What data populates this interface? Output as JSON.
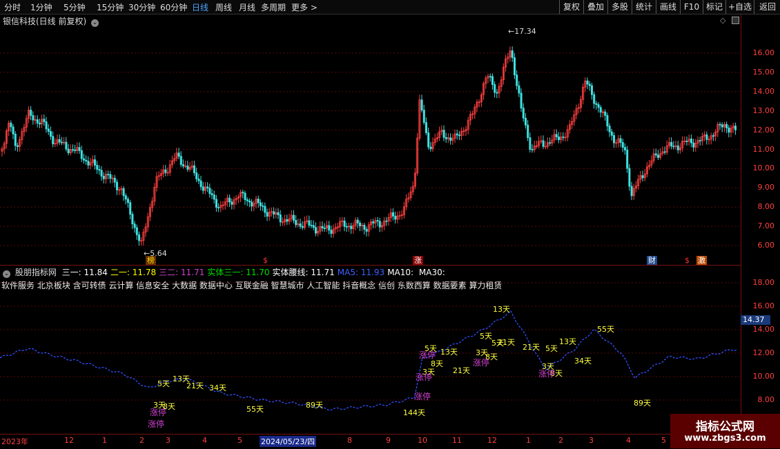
{
  "toolbar": {
    "periods": [
      "分时",
      "1分钟",
      "5分钟",
      "15分钟",
      "30分钟",
      "60分钟",
      "日线",
      "周线",
      "月线",
      "多周期",
      "更多 >"
    ],
    "active_period": "日线",
    "buttons": [
      "复权",
      "叠加",
      "多股",
      "统计",
      "画线",
      "F10",
      "标记",
      "+自选",
      "返回"
    ]
  },
  "main_pane": {
    "title": "银信科技(日线 前复权)",
    "price_high_label": "17.34",
    "price_low_label": "5.64",
    "y_ticks": [
      "16.00",
      "15.00",
      "14.00",
      "13.00",
      "12.00",
      "11.00",
      "10.00",
      "9.00",
      "8.00",
      "7.00",
      "6.00"
    ],
    "markers": [
      {
        "text": "榜",
        "color": "#ffd700",
        "bg": "#663300"
      },
      {
        "text": "$",
        "color": "#ff3030",
        "bg": "#000"
      },
      {
        "text": "涨",
        "color": "#ffffff",
        "bg": "#8b0000"
      },
      {
        "text": "财",
        "color": "#ffffff",
        "bg": "#1f4a8a"
      },
      {
        "text": "$",
        "color": "#ff3030",
        "bg": "#000"
      },
      {
        "text": "激",
        "color": "#ffffff",
        "bg": "#b84a00"
      }
    ]
  },
  "indicator_pane": {
    "name": "股朋指标网",
    "values": [
      {
        "label": "三一:",
        "value": "11.84",
        "color": "#ffffff"
      },
      {
        "label": "二一:",
        "value": "11.78",
        "color": "#ffff00"
      },
      {
        "label": "三二:",
        "value": "11.71",
        "color": "#d040d0"
      },
      {
        "label": "实体三一:",
        "value": "11.70",
        "color": "#00e000"
      },
      {
        "label": "实体腰线:",
        "value": "11.71",
        "color": "#ffffff"
      },
      {
        "label": "MA5:",
        "value": "11.93",
        "color": "#4060ff"
      },
      {
        "label": "MA10:",
        "value": "",
        "color": "#ffffff"
      },
      {
        "label": "MA30:",
        "value": "",
        "color": "#ffffff"
      }
    ],
    "concepts": "软件服务 北京板块 含可转债 云计算 信息安全 大数据 数据中心 互联金融 智慧城市 人工智能 抖音概念 信创 东数西算 数据要素 算力租赁",
    "y_ticks": [
      "18.00",
      "16.00",
      "14.00",
      "12.00",
      "10.00",
      "8.00"
    ],
    "current_value": "14.37",
    "day_labels": [
      {
        "text": "5天",
        "color": "#ffff40"
      },
      {
        "text": "13天",
        "color": "#ffff40"
      },
      {
        "text": "21天",
        "color": "#ffff40"
      },
      {
        "text": "34天",
        "color": "#ffff40"
      },
      {
        "text": "3天",
        "color": "#ffff40"
      },
      {
        "text": "8天",
        "color": "#ffff40"
      },
      {
        "text": "55天",
        "color": "#ffff40"
      },
      {
        "text": "89天",
        "color": "#ffff40"
      },
      {
        "text": "144天",
        "color": "#ffff40"
      },
      {
        "text": "5天",
        "color": "#ffff40"
      },
      {
        "text": "13天",
        "color": "#ffff40"
      },
      {
        "text": "8天",
        "color": "#ffff40"
      },
      {
        "text": "3天",
        "color": "#ffff40"
      },
      {
        "text": "21天",
        "color": "#ffff40"
      },
      {
        "text": "5天",
        "color": "#ffff40"
      },
      {
        "text": "13天",
        "color": "#ffff40"
      },
      {
        "text": "3天",
        "color": "#ffff40"
      },
      {
        "text": "8天",
        "color": "#ffff40"
      },
      {
        "text": "5天",
        "color": "#ffff40"
      },
      {
        "text": "21天",
        "color": "#ffff40"
      },
      {
        "text": "5天",
        "color": "#ffff40"
      },
      {
        "text": "13天",
        "color": "#ffff40"
      },
      {
        "text": "3天",
        "color": "#ffff40"
      },
      {
        "text": "8天",
        "color": "#ffff40"
      },
      {
        "text": "21天",
        "color": "#ffff40"
      },
      {
        "text": "34天",
        "color": "#ffff40"
      },
      {
        "text": "55天",
        "color": "#ffff40"
      },
      {
        "text": "89天",
        "color": "#ffff40"
      }
    ],
    "limit_up_labels": [
      "涨停",
      "涨停",
      "涨停",
      "涨停",
      "涨停",
      "涨停",
      "涨停"
    ]
  },
  "x_axis": {
    "labels": [
      "2023年",
      "12",
      "1",
      "2",
      "3",
      "4",
      "5",
      "2024/05/23/四",
      "8",
      "9",
      "10",
      "11",
      "12",
      "1",
      "2",
      "3",
      "4",
      "5"
    ]
  },
  "watermark": {
    "title": "指标公式网",
    "url": "www.zbgs3.com"
  },
  "colors": {
    "up": "#ff4040",
    "down": "#40e0e0",
    "grid": "#7a1010",
    "ma": "#3050ff"
  }
}
